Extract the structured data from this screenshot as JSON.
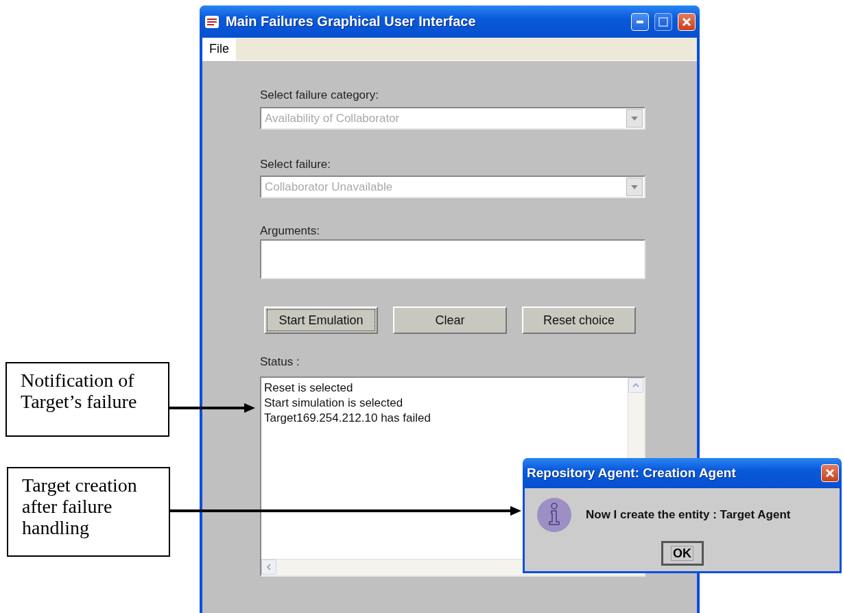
{
  "main_window": {
    "title": "Main Failures Graphical User Interface",
    "menu": [
      {
        "label": "File"
      }
    ],
    "failure_category": {
      "label": "Select failure category:",
      "value": "Availability of Collaborator",
      "disabled": true
    },
    "failure": {
      "label": "Select failure:",
      "value": "Collaborator Unavailable",
      "disabled": true
    },
    "arguments": {
      "label": "Arguments:"
    },
    "buttons": [
      {
        "label": "Start Emulation",
        "focused": true
      },
      {
        "label": "Clear",
        "focused": false
      },
      {
        "label": "Reset choice",
        "focused": false
      }
    ],
    "status": {
      "label": "Status :",
      "lines": [
        "Reset is selected",
        "Start simulation is selected",
        "Target169.254.212.10 has failed"
      ]
    }
  },
  "dialog": {
    "title": "Repository Agent: Creation Agent",
    "message": "Now I create the entity : Target Agent",
    "button": "OK"
  },
  "callouts": [
    {
      "text": "Notification of Target’s failure"
    },
    {
      "text": "Target creation after failure handling"
    }
  ]
}
